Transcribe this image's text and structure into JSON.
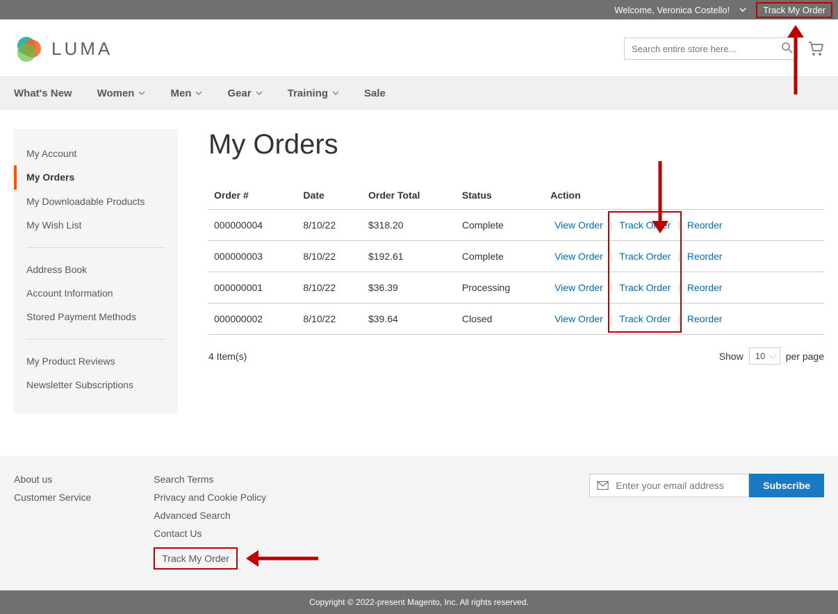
{
  "header": {
    "welcome": "Welcome, Veronica Costello!",
    "track_my_order": "Track My Order",
    "logo_text": "LUMA",
    "search_placeholder": "Search entire store here..."
  },
  "nav": {
    "items": [
      {
        "label": "What's New",
        "chevron": false
      },
      {
        "label": "Women",
        "chevron": true
      },
      {
        "label": "Men",
        "chevron": true
      },
      {
        "label": "Gear",
        "chevron": true
      },
      {
        "label": "Training",
        "chevron": true
      },
      {
        "label": "Sale",
        "chevron": false
      }
    ]
  },
  "sidebar": {
    "groups": [
      [
        "My Account",
        "My Orders",
        "My Downloadable Products",
        "My Wish List"
      ],
      [
        "Address Book",
        "Account Information",
        "Stored Payment Methods"
      ],
      [
        "My Product Reviews",
        "Newsletter Subscriptions"
      ]
    ],
    "current": "My Orders"
  },
  "page": {
    "title": "My Orders"
  },
  "orders_table": {
    "headers": [
      "Order #",
      "Date",
      "Order Total",
      "Status",
      "Action"
    ],
    "action_labels": {
      "view": "View Order",
      "track": "Track Order",
      "reorder": "Reorder"
    },
    "rows": [
      {
        "order_no": "000000004",
        "date": "8/10/22",
        "total": "$318.20",
        "status": "Complete"
      },
      {
        "order_no": "000000003",
        "date": "8/10/22",
        "total": "$192.61",
        "status": "Complete"
      },
      {
        "order_no": "000000001",
        "date": "8/10/22",
        "total": "$36.39",
        "status": "Processing"
      },
      {
        "order_no": "000000002",
        "date": "8/10/22",
        "total": "$39.64",
        "status": "Closed"
      }
    ]
  },
  "toolbar": {
    "count_text": "4 Item(s)",
    "show_label": "Show",
    "per_page_label": "per page",
    "limit_value": "10"
  },
  "footer": {
    "col1": [
      "About us",
      "Customer Service"
    ],
    "col2": [
      "Search Terms",
      "Privacy and Cookie Policy",
      "Advanced Search",
      "Contact Us",
      "Track My Order"
    ],
    "newsletter_placeholder": "Enter your email address",
    "subscribe_label": "Subscribe"
  },
  "copyright": "Copyright © 2022-present Magento, Inc. All rights reserved."
}
